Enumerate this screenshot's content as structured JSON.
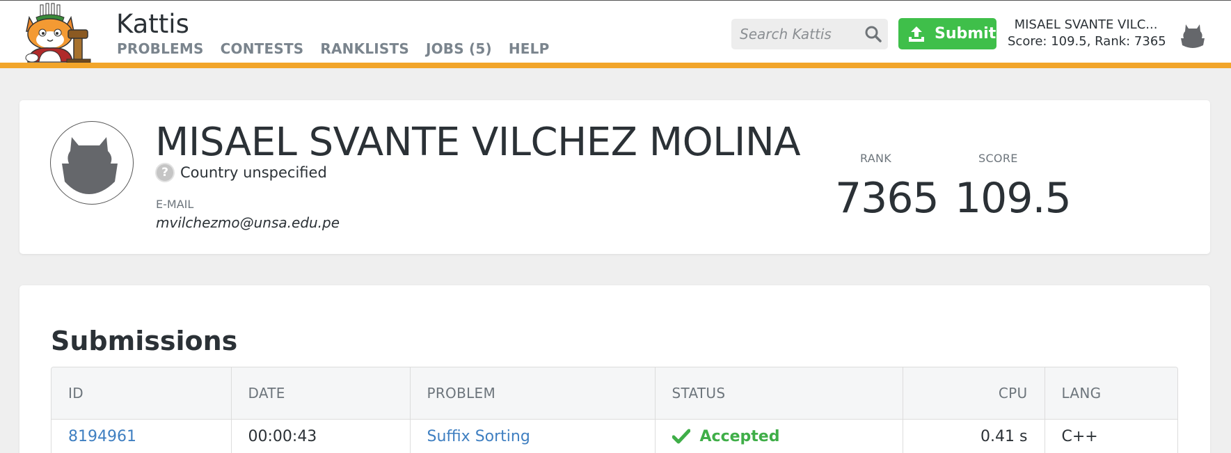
{
  "header": {
    "brand": "Kattis",
    "nav": [
      "PROBLEMS",
      "CONTESTS",
      "RANKLISTS",
      "JOBS (5)",
      "HELP"
    ],
    "search_placeholder": "Search Kattis",
    "submit_label": "Submit",
    "user_name": "MISAEL SVANTE VILC...",
    "user_score_rank": "Score: 109.5, Rank: 7365"
  },
  "profile": {
    "name": "MISAEL SVANTE VILCHEZ MOLINA",
    "country_icon": "?",
    "country": "Country unspecified",
    "email_label": "E-MAIL",
    "email": "mvilchezmo@unsa.edu.pe",
    "rank_label": "RANK",
    "rank": "7365",
    "score_label": "SCORE",
    "score": "109.5"
  },
  "submissions": {
    "title": "Submissions",
    "columns": [
      "ID",
      "DATE",
      "PROBLEM",
      "STATUS",
      "CPU",
      "LANG"
    ],
    "rows": [
      {
        "id": "8194961",
        "date": "00:00:43",
        "problem": "Suffix Sorting",
        "status": "Accepted",
        "cpu": "0.41 s",
        "lang": "C++"
      }
    ]
  },
  "colors": {
    "accent": "#f2a52a",
    "submit_green": "#3fbf4a",
    "link_blue": "#3f7fc1",
    "accepted_green": "#3fae48"
  }
}
